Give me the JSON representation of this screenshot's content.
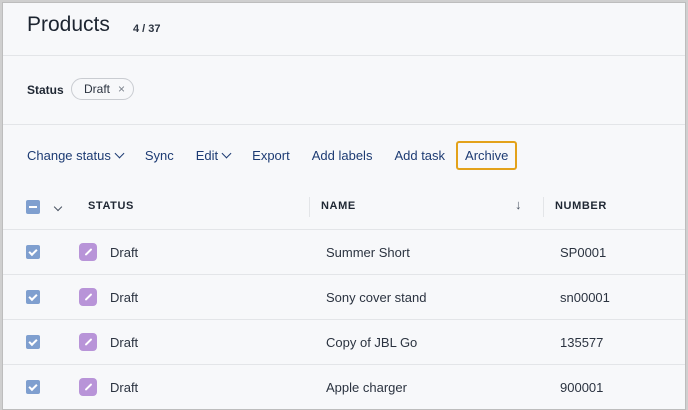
{
  "header": {
    "title": "Products",
    "count": "4 / 37"
  },
  "filter": {
    "label": "Status",
    "chip": "Draft",
    "chip_remove": "×"
  },
  "toolbar": {
    "change_status": "Change status",
    "sync": "Sync",
    "edit": "Edit",
    "export": "Export",
    "add_labels": "Add labels",
    "add_task": "Add task",
    "archive": "Archive"
  },
  "table": {
    "columns": {
      "status": "STATUS",
      "name": "NAME",
      "number": "NUMBER"
    },
    "sort_indicator": "↓",
    "rows": [
      {
        "status": "Draft",
        "name": "Summer Short",
        "number": "SP0001"
      },
      {
        "status": "Draft",
        "name": "Sony cover stand",
        "number": "sn00001"
      },
      {
        "status": "Draft",
        "name": "Copy of JBL Go",
        "number": "135577"
      },
      {
        "status": "Draft",
        "name": "Apple charger",
        "number": "900001"
      }
    ]
  },
  "colors": {
    "accent": "#1d3b73",
    "highlight": "#e3a21a",
    "checkbox": "#7f9fcf",
    "draft_icon": "#b894d8"
  }
}
